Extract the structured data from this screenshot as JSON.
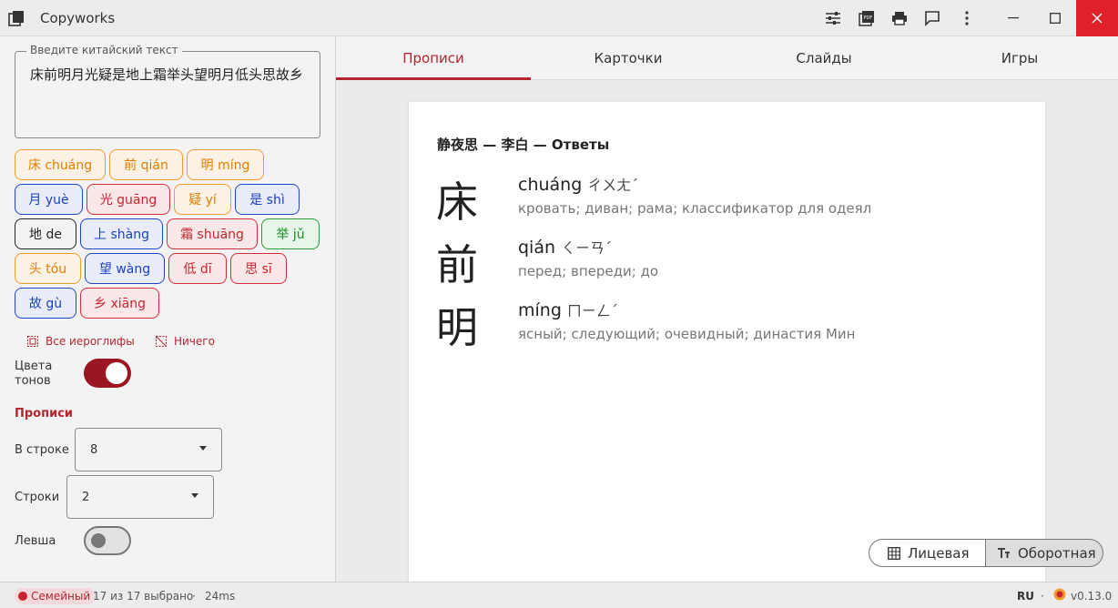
{
  "window": {
    "title": "Copyworks"
  },
  "left": {
    "input_legend": "Введите китайский текст",
    "input_value": "床前明月光疑是地上霜举头望明月低头思故乡",
    "chips": [
      {
        "label": "床 chuáng",
        "tone": "orange"
      },
      {
        "label": "前 qián",
        "tone": "orange"
      },
      {
        "label": "明 míng",
        "tone": "orange"
      },
      {
        "label": "月 yuè",
        "tone": "blue"
      },
      {
        "label": "光 guāng",
        "tone": "red"
      },
      {
        "label": "疑 yí",
        "tone": "orange"
      },
      {
        "label": "是 shì",
        "tone": "blue"
      },
      {
        "label": "地 de",
        "tone": "black"
      },
      {
        "label": "上 shàng",
        "tone": "blue"
      },
      {
        "label": "霜 shuāng",
        "tone": "red"
      },
      {
        "label": "举 jǔ",
        "tone": "green"
      },
      {
        "label": "头 tóu",
        "tone": "orange"
      },
      {
        "label": "望 wàng",
        "tone": "blue"
      },
      {
        "label": "低 dī",
        "tone": "red"
      },
      {
        "label": "思 sī",
        "tone": "red"
      },
      {
        "label": "故 gù",
        "tone": "blue"
      },
      {
        "label": "乡 xiāng",
        "tone": "red"
      }
    ],
    "select_all": "Все иероглифы",
    "select_none": "Ничего",
    "tone_colors_label": "Цвета тонов",
    "tone_colors_on": true,
    "section_title": "Прописи",
    "per_row_label": "В строке",
    "per_row_value": "8",
    "rows_label": "Строки",
    "rows_value": "2",
    "lefty_label": "Левша",
    "lefty_on": false
  },
  "tabs": [
    "Прописи",
    "Карточки",
    "Слайды",
    "Игры"
  ],
  "active_tab": "Прописи",
  "card": {
    "title": "静夜思 — 李白 — Ответы",
    "entries": [
      {
        "hanzi": "床",
        "pinyin": "chuáng",
        "bopomofo": "ㄔㄨㄤˊ",
        "gloss": "кровать; диван; рама; классификатор для одеял"
      },
      {
        "hanzi": "前",
        "pinyin": "qián",
        "bopomofo": "ㄑㄧㄢˊ",
        "gloss": "перед; впереди; до"
      },
      {
        "hanzi": "明",
        "pinyin": "míng",
        "bopomofo": "ㄇㄧㄥˊ",
        "gloss": "ясный; следующий; очевидный; династия Мин"
      }
    ]
  },
  "view_toggle": {
    "front": "Лицевая",
    "back": "Оборотная",
    "selected": "Оборотная"
  },
  "status": {
    "badge": "Семейный",
    "selection": "17 из 17 выбрано",
    "timing": "24ms",
    "lang": "RU",
    "version": "v0.13.0"
  },
  "colors": {
    "accent": "#b3262f",
    "tone_orange": "#e07f00",
    "tone_blue": "#1b3fc2",
    "tone_red": "#c6252f",
    "tone_green": "#1b8c29",
    "close_button": "#e0202a"
  }
}
